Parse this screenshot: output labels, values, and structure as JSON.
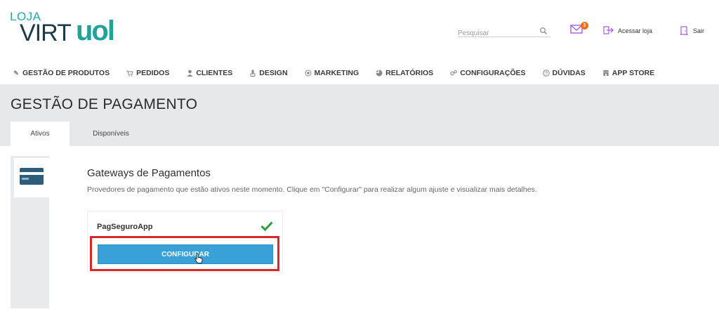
{
  "logo": {
    "line1": "LOJA",
    "line2": "VIRT",
    "line3": "uol"
  },
  "header": {
    "search_placeholder": "Pesquisar",
    "mail_badge": "3",
    "acessar_label": "Acessar loja",
    "sair_label": "Sair"
  },
  "nav": {
    "items": [
      {
        "label": "GESTÃO DE PRODUTOS",
        "icon": "edit-icon"
      },
      {
        "label": "PEDIDOS",
        "icon": "cart-icon"
      },
      {
        "label": "CLIENTES",
        "icon": "user-icon"
      },
      {
        "label": "DESIGN",
        "icon": "brush-icon"
      },
      {
        "label": "MARKETING",
        "icon": "target-icon"
      },
      {
        "label": "RELATÓRIOS",
        "icon": "chart-icon"
      },
      {
        "label": "CONFIGURAÇÕES",
        "icon": "gears-icon"
      },
      {
        "label": "DÚVIDAS",
        "icon": "help-icon"
      },
      {
        "label": "APP STORE",
        "icon": "store-icon"
      }
    ]
  },
  "page": {
    "title": "GESTÃO DE PAGAMENTO",
    "tabs": [
      {
        "label": "Ativos",
        "active": true
      },
      {
        "label": "Disponíveis",
        "active": false
      }
    ]
  },
  "content": {
    "title": "Gateways de Pagamentos",
    "subtitle": "Provedores de pagamento que estão ativos neste momento. Clique em \"Configurar\" para realizar algum ajuste e visualizar mais detalhes.",
    "gateway": {
      "name": "PagSeguroApp",
      "button_label": "Configurar"
    }
  },
  "colors": {
    "accent": "#3aa0d8",
    "brand": "#21a39b",
    "highlight": "#d62a2a",
    "check": "#2e9e3a"
  }
}
